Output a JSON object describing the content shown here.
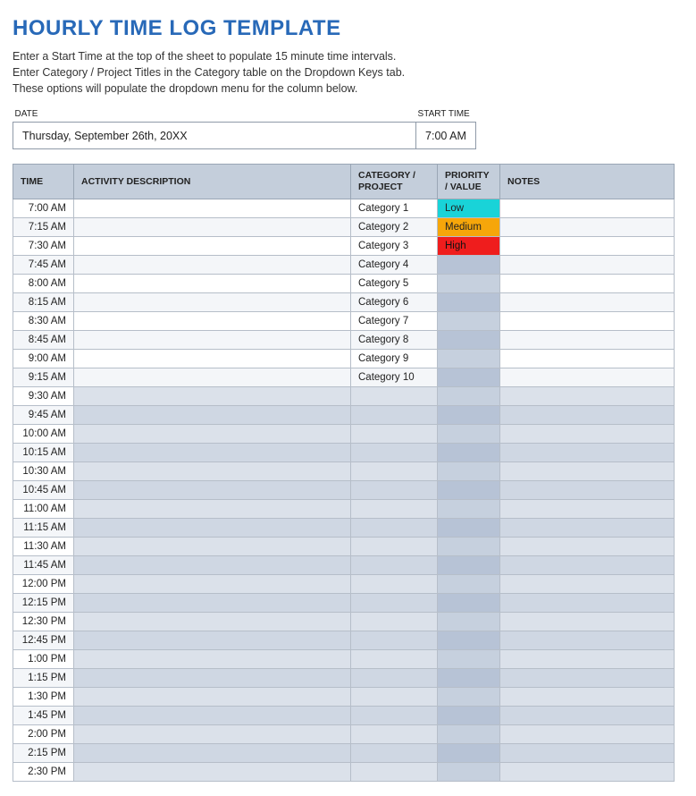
{
  "title": "HOURLY TIME LOG TEMPLATE",
  "instructions": [
    "Enter a Start Time at the top of the sheet to populate 15 minute time intervals.",
    "Enter Category / Project Titles in the Category table on the Dropdown Keys tab.",
    "These options will populate the dropdown menu for the column below."
  ],
  "meta": {
    "date_label": "DATE",
    "start_time_label": "START TIME",
    "date_value": "Thursday, September 26th, 20XX",
    "start_time_value": "7:00 AM"
  },
  "headers": {
    "time": "TIME",
    "activity": "ACTIVITY DESCRIPTION",
    "category": "CATEGORY / PROJECT",
    "priority": "PRIORITY / VALUE",
    "notes": "NOTES"
  },
  "priority_styles": {
    "Low": "pri-low",
    "Medium": "pri-med",
    "High": "pri-high"
  },
  "rows": [
    {
      "time": "7:00 AM",
      "activity": "",
      "category": "Category 1",
      "priority": "Low",
      "notes": ""
    },
    {
      "time": "7:15 AM",
      "activity": "",
      "category": "Category 2",
      "priority": "Medium",
      "notes": ""
    },
    {
      "time": "7:30 AM",
      "activity": "",
      "category": "Category 3",
      "priority": "High",
      "notes": ""
    },
    {
      "time": "7:45 AM",
      "activity": "",
      "category": "Category 4",
      "priority": "",
      "notes": ""
    },
    {
      "time": "8:00 AM",
      "activity": "",
      "category": "Category 5",
      "priority": "",
      "notes": ""
    },
    {
      "time": "8:15 AM",
      "activity": "",
      "category": "Category 6",
      "priority": "",
      "notes": ""
    },
    {
      "time": "8:30 AM",
      "activity": "",
      "category": "Category 7",
      "priority": "",
      "notes": ""
    },
    {
      "time": "8:45 AM",
      "activity": "",
      "category": "Category 8",
      "priority": "",
      "notes": ""
    },
    {
      "time": "9:00 AM",
      "activity": "",
      "category": "Category 9",
      "priority": "",
      "notes": ""
    },
    {
      "time": "9:15 AM",
      "activity": "",
      "category": "Category 10",
      "priority": "",
      "notes": ""
    },
    {
      "time": "9:30 AM",
      "activity": "",
      "category": "",
      "priority": "",
      "notes": ""
    },
    {
      "time": "9:45 AM",
      "activity": "",
      "category": "",
      "priority": "",
      "notes": ""
    },
    {
      "time": "10:00 AM",
      "activity": "",
      "category": "",
      "priority": "",
      "notes": ""
    },
    {
      "time": "10:15 AM",
      "activity": "",
      "category": "",
      "priority": "",
      "notes": ""
    },
    {
      "time": "10:30 AM",
      "activity": "",
      "category": "",
      "priority": "",
      "notes": ""
    },
    {
      "time": "10:45 AM",
      "activity": "",
      "category": "",
      "priority": "",
      "notes": ""
    },
    {
      "time": "11:00 AM",
      "activity": "",
      "category": "",
      "priority": "",
      "notes": ""
    },
    {
      "time": "11:15 AM",
      "activity": "",
      "category": "",
      "priority": "",
      "notes": ""
    },
    {
      "time": "11:30 AM",
      "activity": "",
      "category": "",
      "priority": "",
      "notes": ""
    },
    {
      "time": "11:45 AM",
      "activity": "",
      "category": "",
      "priority": "",
      "notes": ""
    },
    {
      "time": "12:00 PM",
      "activity": "",
      "category": "",
      "priority": "",
      "notes": ""
    },
    {
      "time": "12:15 PM",
      "activity": "",
      "category": "",
      "priority": "",
      "notes": ""
    },
    {
      "time": "12:30 PM",
      "activity": "",
      "category": "",
      "priority": "",
      "notes": ""
    },
    {
      "time": "12:45 PM",
      "activity": "",
      "category": "",
      "priority": "",
      "notes": ""
    },
    {
      "time": "1:00 PM",
      "activity": "",
      "category": "",
      "priority": "",
      "notes": ""
    },
    {
      "time": "1:15 PM",
      "activity": "",
      "category": "",
      "priority": "",
      "notes": ""
    },
    {
      "time": "1:30 PM",
      "activity": "",
      "category": "",
      "priority": "",
      "notes": ""
    },
    {
      "time": "1:45 PM",
      "activity": "",
      "category": "",
      "priority": "",
      "notes": ""
    },
    {
      "time": "2:00 PM",
      "activity": "",
      "category": "",
      "priority": "",
      "notes": ""
    },
    {
      "time": "2:15 PM",
      "activity": "",
      "category": "",
      "priority": "",
      "notes": ""
    },
    {
      "time": "2:30 PM",
      "activity": "",
      "category": "",
      "priority": "",
      "notes": ""
    }
  ]
}
